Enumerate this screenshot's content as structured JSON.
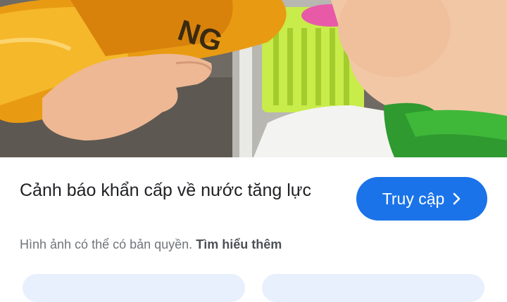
{
  "image": {
    "description": "Child drinking from a bottle of orange energy drink"
  },
  "result": {
    "title": "Cảnh báo khẩn cấp về nước tăng lực",
    "visit_label": "Truy cập",
    "copyright_notice": "Hình ảnh có thể có bản quyền.",
    "learn_more": "Tìm hiểu thêm"
  },
  "colors": {
    "accent": "#1a73e8",
    "chip": "#e8f0fe",
    "text": "#202124",
    "muted": "#70757a"
  },
  "icons": {
    "visit": "chevron-right-icon"
  }
}
